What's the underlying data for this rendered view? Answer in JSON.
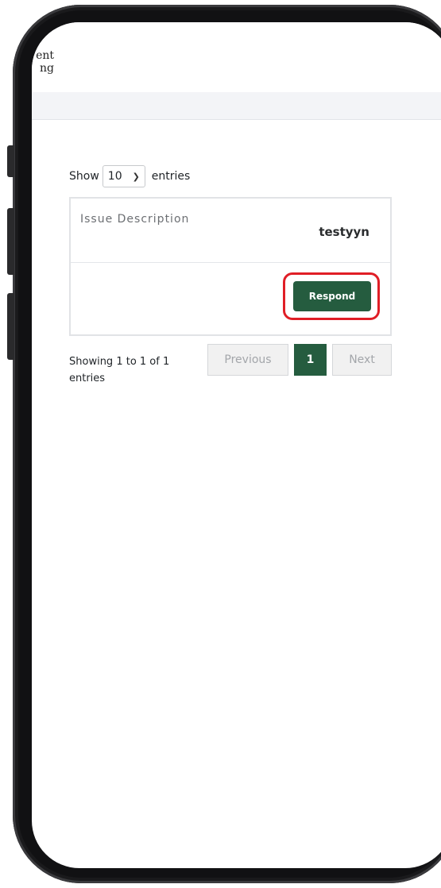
{
  "header": {
    "brand_line1": "ent",
    "brand_line2": "ng"
  },
  "table": {
    "length_prefix": "Show",
    "length_value": "10",
    "length_suffix": "entries",
    "row": {
      "label": "Issue Description",
      "value": "testyyn"
    },
    "action_label": "Respond",
    "info": "Showing 1 to 1 of 1 entries",
    "pagination": {
      "previous": "Previous",
      "current": "1",
      "next": "Next"
    }
  },
  "icons": {
    "select_chevron": "chevron-down-icon"
  },
  "colors": {
    "primary": "#255c3f",
    "highlight": "#e01e26"
  }
}
